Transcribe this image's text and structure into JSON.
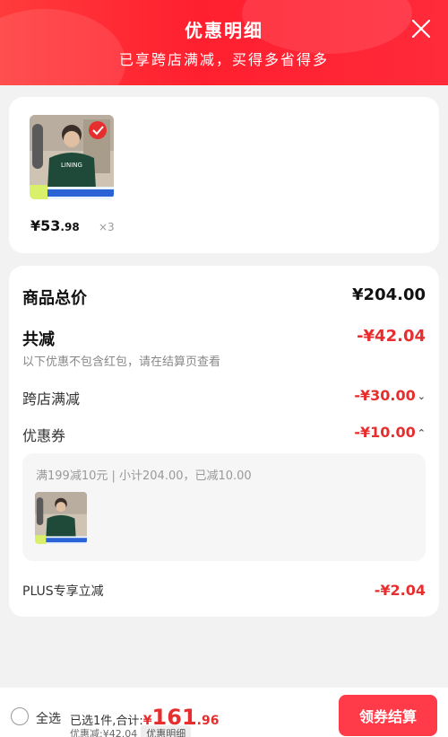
{
  "header": {
    "title": "优惠明细",
    "subtitle": "已享跨店满减，买得多省得多"
  },
  "product": {
    "price_int": "¥53",
    "price_dec": ".98",
    "qty": "×3",
    "thumb_badge": "68"
  },
  "summary": {
    "total_label": "商品总价",
    "total_value": "¥204.00",
    "reduce_label": "共减",
    "reduce_value": "-¥42.04",
    "note": "以下优惠不包含红包，请在结算页查看",
    "cross_store_label": "跨店满减",
    "cross_store_value": "-¥30.00",
    "coupon_label": "优惠券",
    "coupon_value": "-¥10.00",
    "coupon_detail": "满199减10元 | 小计204.00，已减10.00",
    "plus_label": "PLUS专享立减",
    "plus_value": "-¥2.04"
  },
  "bottom": {
    "select_all": "全选",
    "selected_text": "已选1件,合计:",
    "total_currency": "¥",
    "total_int": "161",
    "total_dec": ".96",
    "discount_text": "优惠减:¥42.04",
    "detail_tag": "优惠明细",
    "checkout": "领券结算"
  },
  "colors": {
    "accent_red": "#e62e2e",
    "header_red": "#ff1f2f",
    "button_red": "#ff3b4a"
  }
}
